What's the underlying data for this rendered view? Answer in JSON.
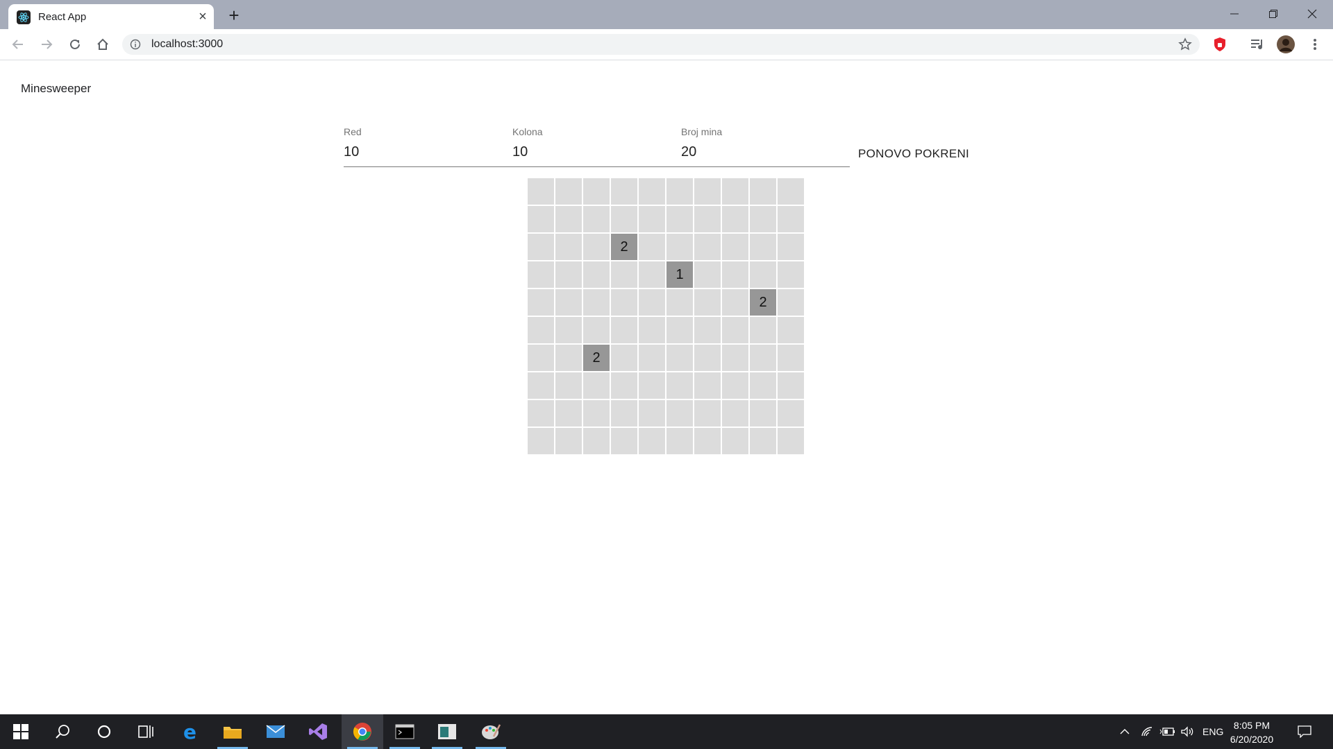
{
  "browser": {
    "tab_title": "React App",
    "url": "localhost:3000"
  },
  "page": {
    "app_title": "Minesweeper",
    "fields": [
      {
        "label": "Red",
        "value": "10"
      },
      {
        "label": "Kolona",
        "value": "10"
      },
      {
        "label": "Broj mina",
        "value": "20"
      }
    ],
    "restart_label": "PONOVO POKRENI",
    "board": {
      "rows": 10,
      "cols": 10,
      "revealed": [
        {
          "row": 3,
          "col": 4,
          "value": "2"
        },
        {
          "row": 4,
          "col": 6,
          "value": "1"
        },
        {
          "row": 5,
          "col": 9,
          "value": "2"
        },
        {
          "row": 7,
          "col": 3,
          "value": "2"
        }
      ]
    }
  },
  "taskbar": {
    "language": "ENG",
    "time": "8:05 PM",
    "date": "6/20/2020"
  },
  "colors": {
    "tabstrip": "#a6acba",
    "cell_hidden": "#dcdcdc",
    "cell_revealed": "#979797",
    "taskbar": "#1f2024"
  }
}
